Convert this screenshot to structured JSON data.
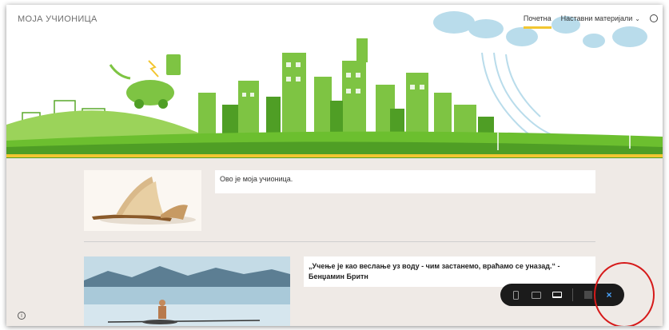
{
  "site": {
    "title": "МОЈА УЧИОНИЦА"
  },
  "nav": {
    "items": [
      {
        "label": "Почетна",
        "active": true
      },
      {
        "label": "Наставни материјали",
        "has_dropdown": true
      }
    ],
    "search_icon": "search-icon"
  },
  "content": {
    "intro_text": "Ово је моја учионица.",
    "quote_line1": "„Учење је као веслање уз воду - чим застанемо, враћамо се уназад.“ -",
    "quote_line2": "Бенџамин Бритн"
  },
  "toolbar": {
    "icons": [
      "phone-icon",
      "tablet-icon",
      "laptop-icon",
      "flag-icon",
      "close-icon"
    ],
    "close_glyph": "×"
  },
  "info": {
    "glyph": "i"
  },
  "colors": {
    "accent_yellow": "#f2c631",
    "banner_green": "#6cbf2f",
    "toolbar_bg": "#1b1b1b",
    "annotation_red": "#d61a1a"
  }
}
